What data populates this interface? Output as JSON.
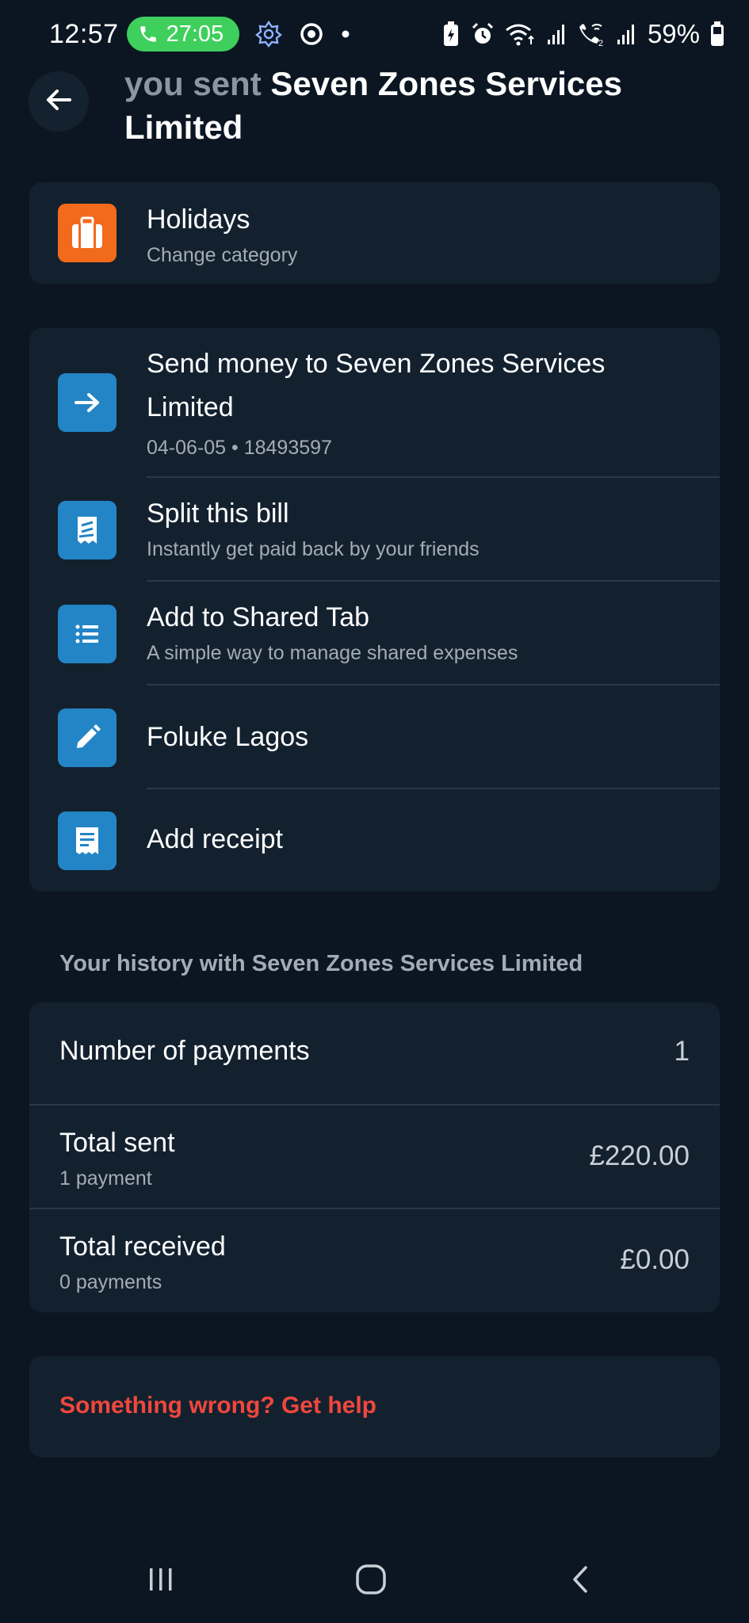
{
  "status_bar": {
    "time": "12:57",
    "call_timer": "27:05",
    "battery_percent": "59%",
    "icons": [
      "phone-icon",
      "app-badge-icon",
      "chrome-icon",
      "dot-icon",
      "battery-saver-icon",
      "alarm-icon",
      "wifi-icon",
      "signal-icon",
      "wifi-calling-icon",
      "signal-icon",
      "battery-icon"
    ]
  },
  "header": {
    "title_muted": "you sent",
    "title_strong": "Seven Zones Services Limited"
  },
  "category_card": {
    "title": "Holidays",
    "subtitle": "Change category",
    "icon": "suitcase-icon",
    "icon_color": "#f26a1b"
  },
  "actions_card": {
    "items": [
      {
        "title": "Send money to Seven Zones Services Limited",
        "subtitle": "04-06-05 • 18493597",
        "icon": "arrow-right-icon"
      },
      {
        "title": "Split this bill",
        "subtitle": "Instantly get paid back by your friends",
        "icon": "split-bill-icon"
      },
      {
        "title": "Add to Shared Tab",
        "subtitle": "A simple way to manage shared expenses",
        "icon": "list-icon"
      },
      {
        "title": "Foluke Lagos",
        "subtitle": "",
        "icon": "pencil-icon"
      },
      {
        "title": "Add receipt",
        "subtitle": "",
        "icon": "receipt-icon"
      }
    ],
    "icon_color": "#2385c6"
  },
  "history": {
    "section_label": "Your history with Seven Zones Services Limited",
    "rows": [
      {
        "label": "Number of payments",
        "sub": "",
        "value": "1"
      },
      {
        "label": "Total sent",
        "sub": "1 payment",
        "value": "£220.00"
      },
      {
        "label": "Total received",
        "sub": "0 payments",
        "value": "£0.00"
      }
    ]
  },
  "help": {
    "label": "Something wrong? Get help",
    "color": "#f0473d"
  },
  "nav_bar": {
    "buttons": [
      "recent-apps-icon",
      "home-icon",
      "back-icon"
    ]
  }
}
